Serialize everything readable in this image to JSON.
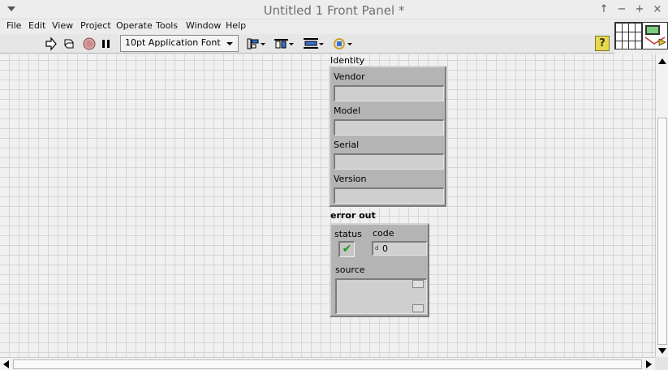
{
  "window": {
    "title": "Untitled 1 Front Panel *",
    "buttons": {
      "up": "↑",
      "minimize": "−",
      "maximize": "+",
      "close": "×"
    }
  },
  "menubar": {
    "items": [
      "File",
      "Edit",
      "View",
      "Project",
      "Operate",
      "Tools",
      "Window",
      "Help"
    ]
  },
  "toolbar": {
    "font": "10pt Application Font",
    "icons": [
      "run-arrow-icon",
      "run-continuously-icon",
      "abort-icon",
      "pause-icon",
      "align-icon",
      "distribute-icon",
      "resize-icon",
      "reorder-icon",
      "help-icon"
    ],
    "help_label": "?"
  },
  "front_panel": {
    "identity": {
      "label": "Identity",
      "fields": [
        {
          "label": "Vendor",
          "value": ""
        },
        {
          "label": "Model",
          "value": ""
        },
        {
          "label": "Serial",
          "value": ""
        },
        {
          "label": "Version",
          "value": ""
        }
      ]
    },
    "error_out": {
      "label": "error out",
      "status_label": "status",
      "status_mark": "✔",
      "code_label": "code",
      "code_value": "0",
      "code_radix": "d",
      "source_label": "source",
      "source_value": ""
    }
  },
  "colors": {
    "cluster": "#b4b4b4",
    "status_ok": "#1b9a1b",
    "help_button": "#e8d84a"
  }
}
